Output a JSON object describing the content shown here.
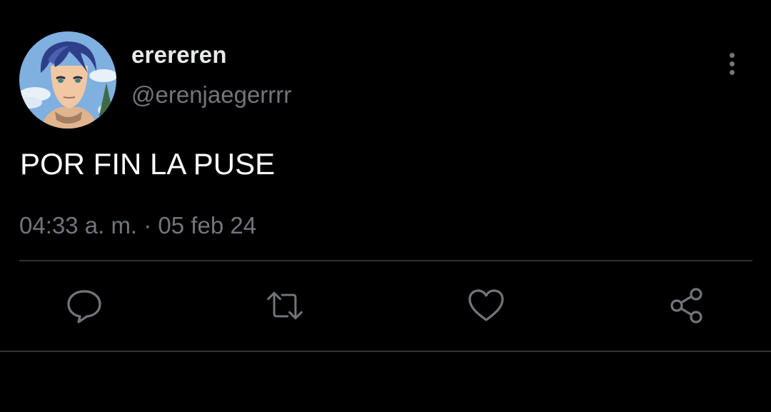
{
  "tweet": {
    "display_name": "erereren",
    "handle": "@erenjaegerrrr",
    "text": "POR FIN LA PUSE",
    "timestamp": "04:33 a. m. · 05 feb 24",
    "avatar": "avatar-anime-character"
  },
  "actions": [
    {
      "name": "reply",
      "icon": "reply-icon"
    },
    {
      "name": "retweet",
      "icon": "retweet-icon"
    },
    {
      "name": "like",
      "icon": "heart-icon"
    },
    {
      "name": "share",
      "icon": "share-icon"
    }
  ],
  "colors": {
    "background": "#000000",
    "primary_text": "#e7e9ea",
    "secondary_text": "#71767b",
    "divider": "#2f3336"
  }
}
